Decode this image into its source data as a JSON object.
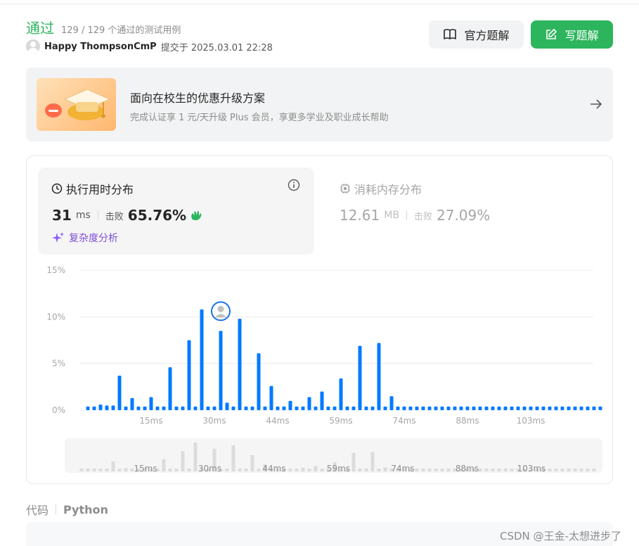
{
  "header": {
    "status": "通过",
    "testcases": "129 / 129 个通过的测试用例",
    "username": "Happy ThompsonCmP",
    "submitted": "提交于 2025.03.01 22:28",
    "official_label": "官方题解",
    "write_label": "写题解"
  },
  "promo": {
    "title": "面向在校生的优惠升级方案",
    "subtitle": "完成认证享 1 元/天升级 Plus 会员，享更多学业及职业成长帮助"
  },
  "runtime": {
    "title": "执行用时分布",
    "value": "31",
    "unit": "ms",
    "beat_label": "击败",
    "beat_pct": "65.76%",
    "complexity_label": "复杂度分析"
  },
  "memory": {
    "title": "消耗内存分布",
    "value": "12.61",
    "unit": "MB",
    "beat_label": "击败",
    "beat_pct": "27.09%"
  },
  "code": {
    "label": "代码",
    "lang": "Python"
  },
  "watermark": "CSDN @王金-太想进步了",
  "colors": {
    "accent_green": "#2db55d",
    "bar_blue": "#007aff",
    "purple": "#7b4fd6"
  },
  "chart_data": {
    "type": "bar",
    "title": "",
    "xlabel": "",
    "ylabel": "",
    "ylim": [
      0,
      15
    ],
    "yticks": [
      "0%",
      "5%",
      "10%",
      "15%"
    ],
    "xticks": [
      "15ms",
      "30ms",
      "44ms",
      "59ms",
      "74ms",
      "88ms",
      "103ms"
    ],
    "values": [
      0.4,
      0.4,
      0.6,
      0.5,
      0.5,
      3.7,
      0.4,
      1.3,
      0.4,
      0.4,
      1.4,
      0.4,
      0.4,
      4.6,
      0.4,
      0.4,
      7.5,
      0.4,
      10.8,
      0.4,
      0.4,
      8.5,
      0.8,
      0.4,
      9.8,
      0.4,
      0.4,
      6.1,
      0.4,
      2.6,
      0.4,
      0.4,
      1.0,
      0.4,
      0.4,
      1.4,
      0.4,
      2.0,
      0.4,
      0.4,
      3.4,
      0.4,
      0.4,
      6.9,
      0.4,
      0.4,
      7.2,
      0.4,
      1.5,
      0.4,
      0.4,
      0.4,
      0.4,
      0.4,
      0.4,
      0.4,
      0.4,
      0.4,
      0.4,
      0.4,
      0.4,
      0.4,
      0.4,
      0.4,
      0.4,
      0.4,
      0.4,
      0.4,
      0.4,
      0.4,
      0.4,
      0.4,
      0.4,
      0.4,
      0.4,
      0.4,
      0.4,
      0.4,
      0.4,
      0.4,
      0.4,
      0.4
    ],
    "highlight_index": 21,
    "grid": true,
    "legend": "none"
  }
}
